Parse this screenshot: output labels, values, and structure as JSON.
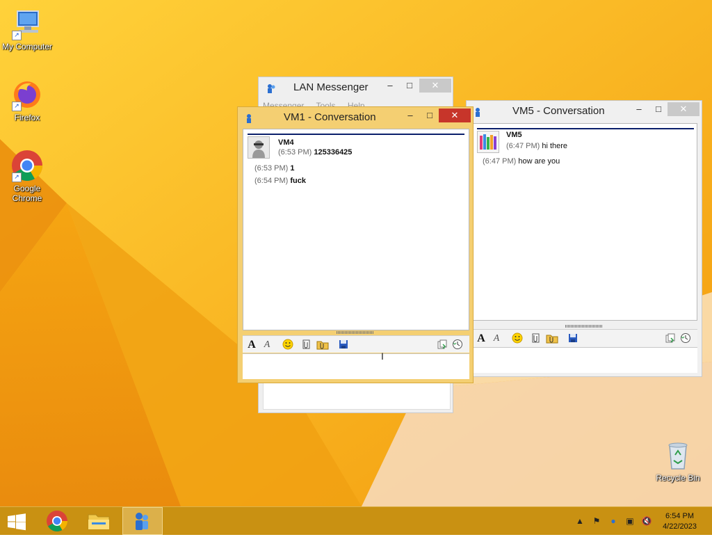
{
  "desktop": {
    "icons": [
      {
        "label": "My Computer"
      },
      {
        "label": "Firefox"
      },
      {
        "label": "Google Chrome"
      },
      {
        "label": "Recycle Bin"
      }
    ]
  },
  "lan_messenger": {
    "title": "LAN Messenger",
    "menu": [
      "Messenger",
      "Tools",
      "Help"
    ]
  },
  "vm1_conversation": {
    "title": "VM1 - Conversation",
    "user": "VM4",
    "messages": [
      {
        "time": "(6:53 PM)",
        "text": "125336425"
      },
      {
        "time": "(6:53 PM)",
        "text": "1"
      },
      {
        "time": "(6:54 PM)",
        "text": "fuck"
      }
    ]
  },
  "vm5_conversation": {
    "title": "VM5 - Conversation",
    "user": "VM5",
    "messages": [
      {
        "time": "(6:47 PM)",
        "text": "hi there"
      },
      {
        "time": "(6:47 PM)",
        "text": "how are you"
      }
    ]
  },
  "window_controls": {
    "minimize": "–",
    "maximize": "□",
    "close": "✕"
  },
  "toolbar_icons": [
    "font-icon",
    "font-style-icon",
    "smiley-icon",
    "attach-file-icon",
    "send-folder-icon",
    "save-icon",
    "copy-icon",
    "history-icon"
  ],
  "taskbar": {
    "time": "6:54 PM",
    "date": "4/22/2023",
    "pinned": [
      "Start",
      "Google Chrome",
      "File Explorer",
      "LAN Messenger"
    ]
  },
  "colors": {
    "accent_orange": "#f6a60f",
    "active_frame": "#f0c65a",
    "inactive_frame": "#eeeeee",
    "close_red": "#c7352a",
    "taskbar": "#c99112"
  }
}
